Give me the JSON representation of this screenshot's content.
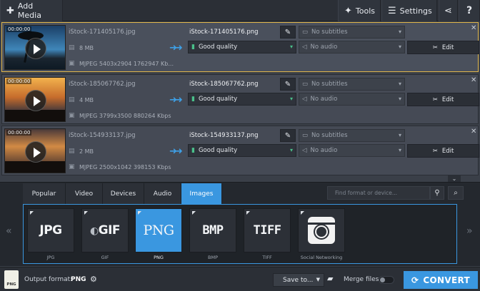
{
  "toolbar": {
    "add_media": "Add Media",
    "tools": "Tools",
    "settings": "Settings"
  },
  "files": [
    {
      "time": "00:00:00",
      "source_name": "iStock-171405176.jpg",
      "size": "8 MB",
      "codec": "MJPEG 5403x2904 1762947 Kb...",
      "output_name": "iStock-171405176.png",
      "quality": "Good quality",
      "subtitles": "No subtitles",
      "audio": "No audio",
      "edit": "Edit"
    },
    {
      "time": "00:00:00",
      "source_name": "iStock-185067762.jpg",
      "size": "4 MB",
      "codec": "MJPEG 3799x3500 880264 Kbps",
      "output_name": "iStock-185067762.png",
      "quality": "Good quality",
      "subtitles": "No subtitles",
      "audio": "No audio",
      "edit": "Edit"
    },
    {
      "time": "00:00:00",
      "source_name": "iStock-154933137.jpg",
      "size": "2 MB",
      "codec": "MJPEG 2500x1042 398153 Kbps",
      "output_name": "iStock-154933137.png",
      "quality": "Good quality",
      "subtitles": "No subtitles",
      "audio": "No audio",
      "edit": "Edit"
    }
  ],
  "tabs": [
    "Popular",
    "Video",
    "Devices",
    "Audio",
    "Images"
  ],
  "active_tab": "Images",
  "search": {
    "placeholder": "Find format or device..."
  },
  "formats": [
    {
      "logo": "JPG",
      "label": "JPG"
    },
    {
      "logo": "GIF",
      "label": "GIF"
    },
    {
      "logo": "PNG",
      "label": "PNG"
    },
    {
      "logo": "BMP",
      "label": "BMP"
    },
    {
      "logo": "TIFF",
      "label": "TIFF"
    },
    {
      "logo": "",
      "label": "Social Networking"
    }
  ],
  "active_format": "PNG",
  "bottom": {
    "output_icon_text": "PNG",
    "output_label": "Output format:",
    "output_value": "PNG",
    "save_to": "Save to...",
    "merge_label": "Merge files:",
    "convert": "CONVERT"
  },
  "colors": {
    "accent": "#3a97e0",
    "selected_border": "#e0b64a"
  },
  "icons": {
    "add": "plus-icon",
    "tools": "tools-icon",
    "settings": "settings-icon",
    "share": "share-icon",
    "help": "help-icon",
    "edit": "scissors-icon",
    "search": "search-icon",
    "detect": "device-detect-icon",
    "gear": "gear-icon",
    "folder": "folder-icon",
    "convert": "convert-icon"
  }
}
